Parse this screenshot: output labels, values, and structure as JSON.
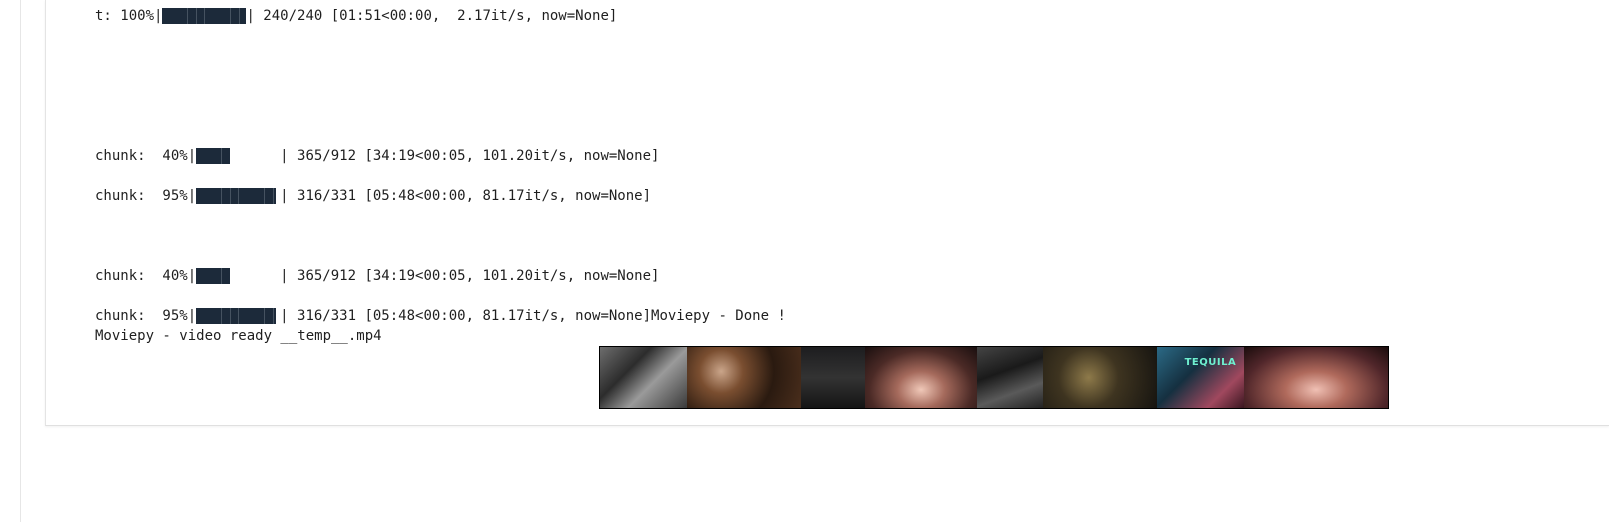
{
  "output": {
    "lines": [
      {
        "prefix": "t: 100%|",
        "progress": 1.0,
        "suffix": "| 240/240 [01:51<00:00,  2.17it/s, now=None]"
      },
      {
        "prefix": "chunk:  40%|",
        "progress": 0.4,
        "suffix": "| 365/912 [34:19<00:05, 101.20it/s, now=None]"
      },
      {
        "prefix": "chunk:  95%|",
        "progress": 0.95,
        "suffix": "| 316/331 [05:48<00:00, 81.17it/s, now=None]"
      },
      {
        "prefix": "chunk:  40%|",
        "progress": 0.4,
        "suffix": "| 365/912 [34:19<00:05, 101.20it/s, now=None]"
      },
      {
        "prefix": "chunk:  95%|",
        "progress": 0.95,
        "suffix": "| 316/331 [05:48<00:00, 81.17it/s, now=None]Moviepy - Done !"
      }
    ],
    "final_line": "Moviepy - video ready __temp__.mp4"
  },
  "filmstrip": {
    "frame_sign_text": "TEQUILA"
  }
}
